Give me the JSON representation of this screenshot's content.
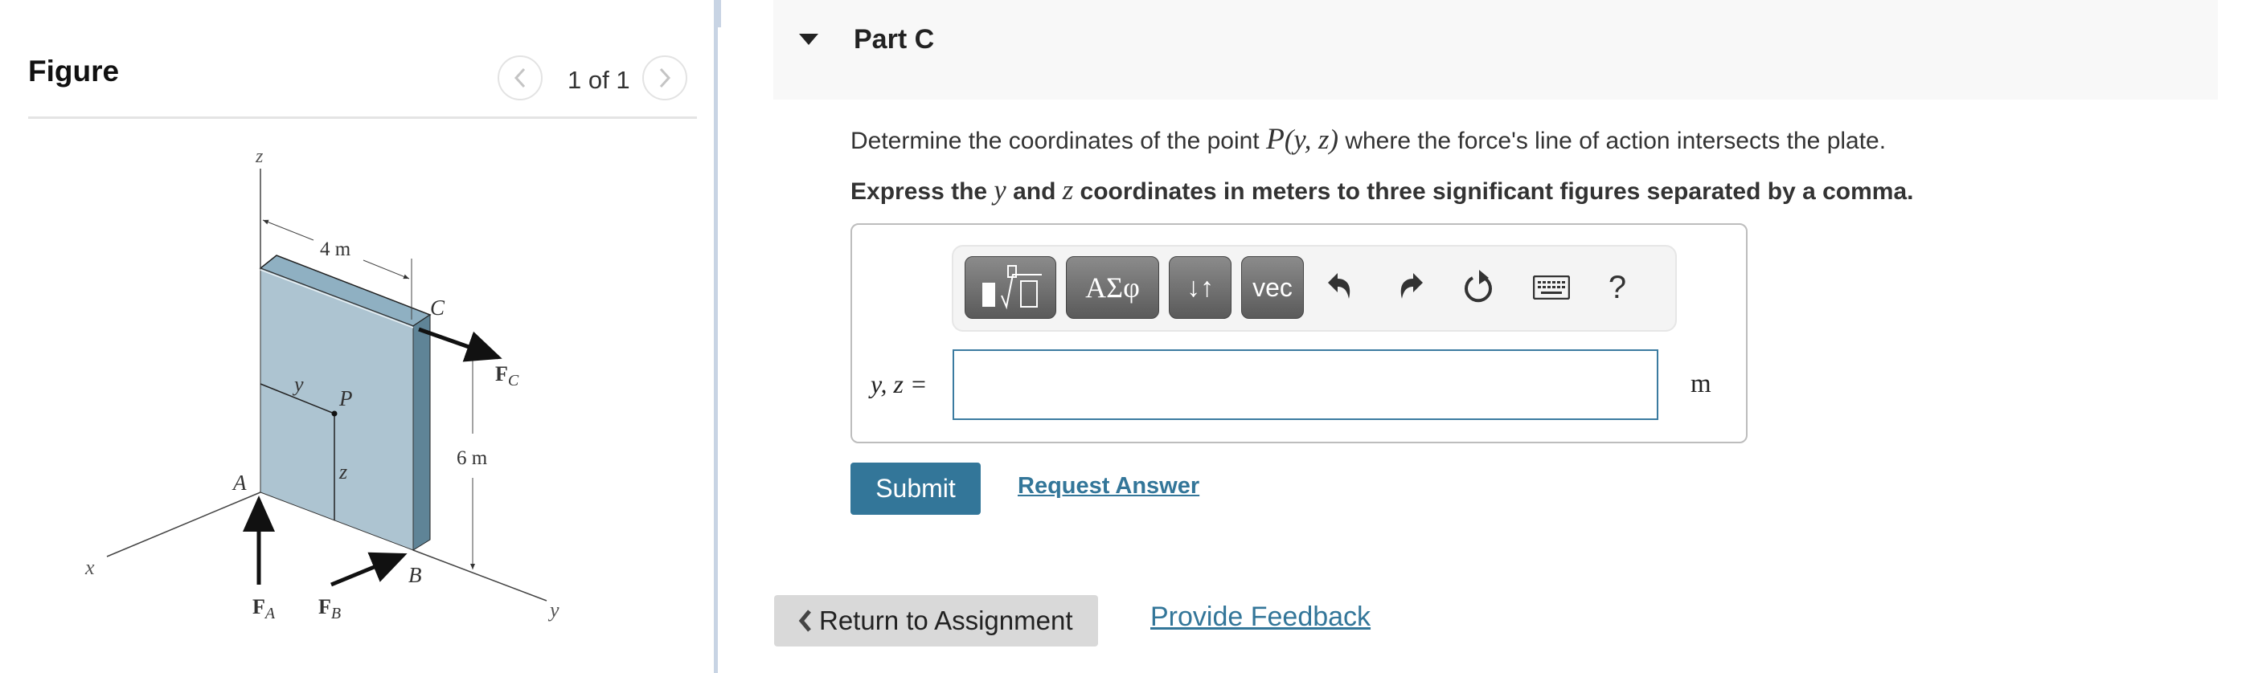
{
  "figure_panel": {
    "heading": "Figure",
    "pagination": {
      "current": "1 of 1",
      "prev_icon": "chevron-left-icon",
      "next_icon": "chevron-right-icon"
    },
    "diagram": {
      "labels": {
        "z_axis": "z",
        "x_axis": "x",
        "y_axis": "y",
        "width_dim": "4 m",
        "height_dim": "6 m",
        "point_a": "A",
        "point_b": "B",
        "point_c": "C",
        "point_p": "P",
        "coord_y": "y",
        "coord_z": "z",
        "force_a": "F",
        "force_a_sub": "A",
        "force_b": "F",
        "force_b_sub": "B",
        "force_c": "F",
        "force_c_sub": "C"
      },
      "colors": {
        "plate_front": "#adc4d1",
        "plate_top": "#8fb0c2",
        "plate_side": "#5f8497"
      }
    }
  },
  "part": {
    "title": "Part C",
    "toggle_icon": "caret-down-icon",
    "question": {
      "before": "Determine the coordinates of the point ",
      "math_p": "P",
      "math_args": "(y, z)",
      "after": " where the force's line of action intersects the plate."
    },
    "instruction": {
      "part1": "Express the ",
      "var_y": "y",
      "part2": " and ",
      "var_z": "z",
      "part3": " coordinates in meters to three significant figures separated by a comma."
    },
    "toolbar": {
      "buttons": [
        {
          "name": "templates",
          "label": ""
        },
        {
          "name": "greek-symbols",
          "label": "ΑΣφ"
        },
        {
          "name": "arrows",
          "label": "↓↑"
        },
        {
          "name": "vector",
          "label": "vec"
        }
      ],
      "icons": [
        "undo-icon",
        "redo-icon",
        "reset-icon",
        "keyboard-icon",
        "help-icon"
      ],
      "help_label": "?"
    },
    "answer": {
      "label": "y, z =",
      "value": "",
      "placeholder": "",
      "unit": "m"
    },
    "submit_label": "Submit",
    "request_answer_label": "Request Answer"
  },
  "footer": {
    "return_label": "Return to Assignment",
    "feedback_label": "Provide Feedback"
  },
  "colors": {
    "accent": "#337699",
    "header_bg": "#f8f8f8",
    "return_bg": "#d9d9d9"
  }
}
